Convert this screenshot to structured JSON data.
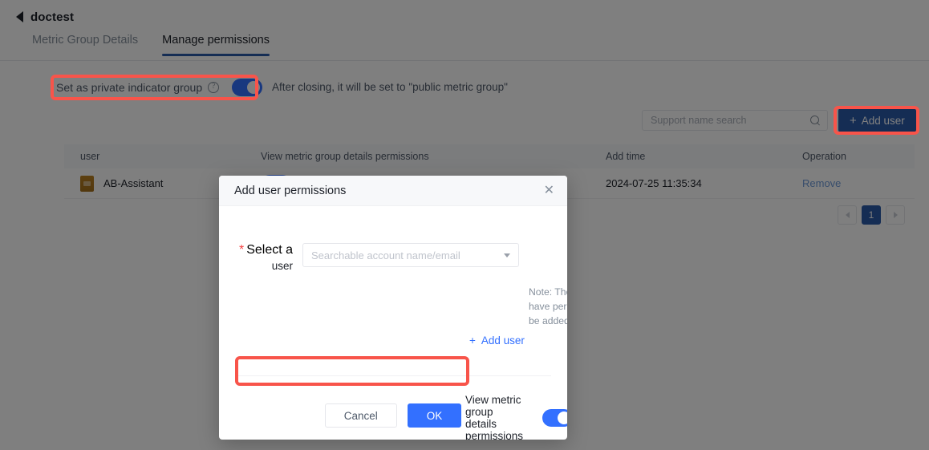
{
  "header": {
    "back_icon": "back-arrow-icon",
    "title": "doctest",
    "tabs": [
      {
        "label": "Metric Group Details",
        "active": false
      },
      {
        "label": "Manage permissions",
        "active": true
      }
    ]
  },
  "privacy": {
    "label": "Set as private indicator group",
    "help_icon": "question-circle-icon",
    "toggle_on": true,
    "hint": "After closing, it will be set to \"public metric group\""
  },
  "toolbar": {
    "search_placeholder": "Support name search",
    "search_value": "",
    "search_icon": "search-icon",
    "add_user_label": "Add user",
    "add_user_plus": "+"
  },
  "table": {
    "columns": [
      "user",
      "View metric group details permissions",
      "Add time",
      "Operation"
    ],
    "rows": [
      {
        "user": "AB-Assistant",
        "avatar_icon": "user-avatar-icon",
        "permission_on": true,
        "add_time": "2024-07-25 11:35:34",
        "operation": "Remove"
      }
    ]
  },
  "pagination": {
    "prev_icon": "chevron-left-icon",
    "next_icon": "chevron-right-icon",
    "pages": [
      "1"
    ],
    "current": "1"
  },
  "modal": {
    "title": "Add user permissions",
    "close_icon": "close-icon",
    "select_user": {
      "required_mark": "*",
      "label_line1": "Select a",
      "label_line2": "user",
      "placeholder": "Searchable account name/email",
      "value": "",
      "caret_icon": "chevron-down-icon"
    },
    "note": "Note: The metric group owner and administrator have permissions by default and do not need to be added manually.",
    "add_user_link": "Add user",
    "add_user_plus": "+",
    "permission": {
      "label": "View metric group details permissions",
      "toggle_on": true
    },
    "cancel_label": "Cancel",
    "ok_label": "OK"
  },
  "colors": {
    "primary_blue": "#3370ff",
    "dark_blue": "#2b5aa8",
    "highlight_red": "#f8544a",
    "avatar_orange": "#bb8122"
  }
}
